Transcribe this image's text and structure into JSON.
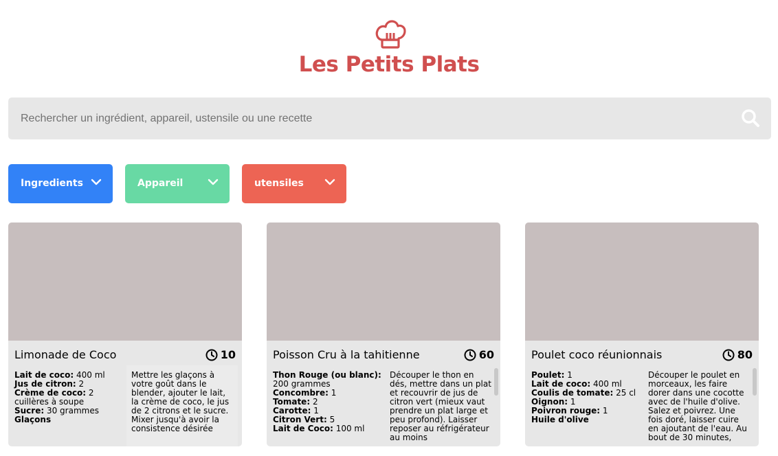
{
  "header": {
    "logo_icon": "chef-hat-icon",
    "title": "Les Petits Plats",
    "brand_color": "#d04f4f"
  },
  "search": {
    "placeholder": "Rechercher un ingrédient, appareil, ustensile ou une recette",
    "icon": "search-icon"
  },
  "filters": [
    {
      "label": "Ingredients",
      "color": "#3282f7",
      "icon": "chevron-down-icon"
    },
    {
      "label": "Appareil",
      "color": "#68d9a4",
      "icon": "chevron-down-icon"
    },
    {
      "label": "utensiles",
      "color": "#ed6454",
      "icon": "chevron-down-icon"
    }
  ],
  "recipes": [
    {
      "name": "Limonade de Coco",
      "time": "10",
      "ingredients": [
        {
          "name": "Lait de coco",
          "quantity": "400 ml"
        },
        {
          "name": "Jus de citron",
          "quantity": "2"
        },
        {
          "name": "Crème de coco",
          "quantity": "2 cuillères à soupe"
        },
        {
          "name": "Sucre",
          "quantity": "30 grammes"
        },
        {
          "name": "Glaçons",
          "quantity": ""
        }
      ],
      "description": "Mettre les glaçons à votre goût dans le blender, ajouter le lait, la crème de coco, le jus de 2 citrons et le sucre. Mixer jusqu'à avoir la consistence désirée"
    },
    {
      "name": "Poisson Cru à la tahitienne",
      "time": "60",
      "ingredients": [
        {
          "name": "Thon Rouge (ou blanc)",
          "quantity": "200 grammes"
        },
        {
          "name": "Concombre",
          "quantity": "1"
        },
        {
          "name": "Tomate",
          "quantity": "2"
        },
        {
          "name": "Carotte",
          "quantity": "1"
        },
        {
          "name": "Citron Vert",
          "quantity": "5"
        },
        {
          "name": "Lait de Coco",
          "quantity": "100 ml"
        }
      ],
      "description": "Découper le thon en dés, mettre dans un plat et recouvrir de jus de citron vert (mieux vaut prendre un plat large et peu profond). Laisser reposer au réfrigérateur au moins"
    },
    {
      "name": "Poulet coco réunionnais",
      "time": "80",
      "ingredients": [
        {
          "name": "Poulet",
          "quantity": "1"
        },
        {
          "name": "Lait de coco",
          "quantity": "400 ml"
        },
        {
          "name": "Coulis de tomate",
          "quantity": "25 cl"
        },
        {
          "name": "Oignon",
          "quantity": "1"
        },
        {
          "name": "Poivron rouge",
          "quantity": "1"
        },
        {
          "name": "Huile d'olive",
          "quantity": ""
        }
      ],
      "description": "Découper le poulet en morceaux, les faire dorer dans une cocotte avec de l'huile d'olive. Salez et poivrez. Une fois doré, laisser cuire en ajoutant de l'eau. Au bout de 30 minutes,"
    }
  ]
}
